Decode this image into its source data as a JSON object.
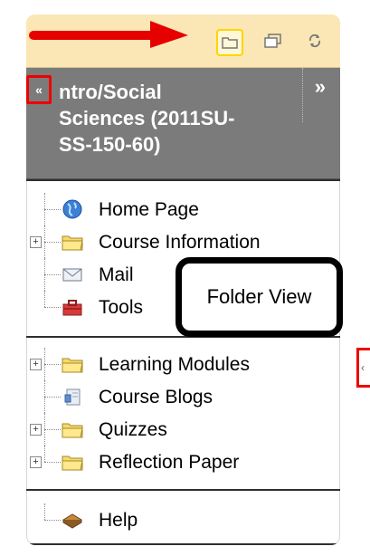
{
  "toolbar": {
    "folder_view_icon": "folder-icon",
    "window_icon": "window-icon",
    "refresh_icon": "refresh-icon",
    "accent": "#fbe7b5",
    "highlight": "#ffd400"
  },
  "course": {
    "title": "ntro/Social\nSciences (2011SU-\nSS-150-60)",
    "collapse_glyph": "«",
    "expand_glyph": "»",
    "header_color": "#7b7b7b"
  },
  "menu": {
    "group1": [
      {
        "label": "Home Page",
        "icon": "globe-icon",
        "expandable": false
      },
      {
        "label": "Course Information",
        "icon": "folder-icon",
        "expandable": true
      },
      {
        "label": "Mail",
        "icon": "mail-icon",
        "expandable": false
      },
      {
        "label": "Tools",
        "icon": "toolbox-icon",
        "expandable": false
      }
    ],
    "group2": [
      {
        "label": "Learning Modules",
        "icon": "folder-icon",
        "expandable": true
      },
      {
        "label": "Course Blogs",
        "icon": "blog-icon",
        "expandable": false
      },
      {
        "label": "Quizzes",
        "icon": "folder-icon",
        "expandable": true
      },
      {
        "label": "Reflection Paper",
        "icon": "folder-icon",
        "expandable": true
      }
    ],
    "group3": [
      {
        "label": "Help",
        "icon": "help-book-icon",
        "expandable": false
      }
    ]
  },
  "tooltip": {
    "text": "Folder View"
  },
  "annotation_color": "#e00000"
}
